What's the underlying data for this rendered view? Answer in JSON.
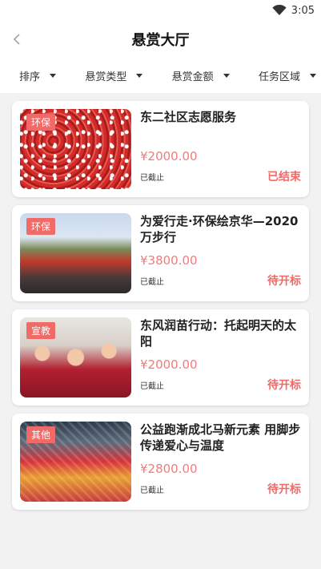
{
  "status_bar": {
    "time": "3:05",
    "wifi_icon": "wifi-icon"
  },
  "header": {
    "title": "悬赏大厅",
    "back_icon": "chevron-left-icon"
  },
  "filters": [
    {
      "label": "排序"
    },
    {
      "label": "悬赏类型"
    },
    {
      "label": "悬赏金额"
    },
    {
      "label": "任务区域"
    }
  ],
  "colors": {
    "accent": "#f06a68",
    "amount": "#f27b7b"
  },
  "cards": [
    {
      "tag": "环保",
      "title": "东二社区志愿服务",
      "amount": "¥2000.00",
      "deadline": "已截止",
      "status": "已结束"
    },
    {
      "tag": "环保",
      "title": "为爱行走·环保绘京华—2020万步行",
      "amount": "¥3800.00",
      "deadline": "已截止",
      "status": "待开标"
    },
    {
      "tag": "宣教",
      "title": "东风润苗行动：托起明天的太阳",
      "amount": "¥2000.00",
      "deadline": "已截止",
      "status": "待开标"
    },
    {
      "tag": "其他",
      "title": "公益跑渐成北马新元素 用脚步传递爱心与温度",
      "amount": "¥2800.00",
      "deadline": "已截止",
      "status": "待开标"
    }
  ]
}
